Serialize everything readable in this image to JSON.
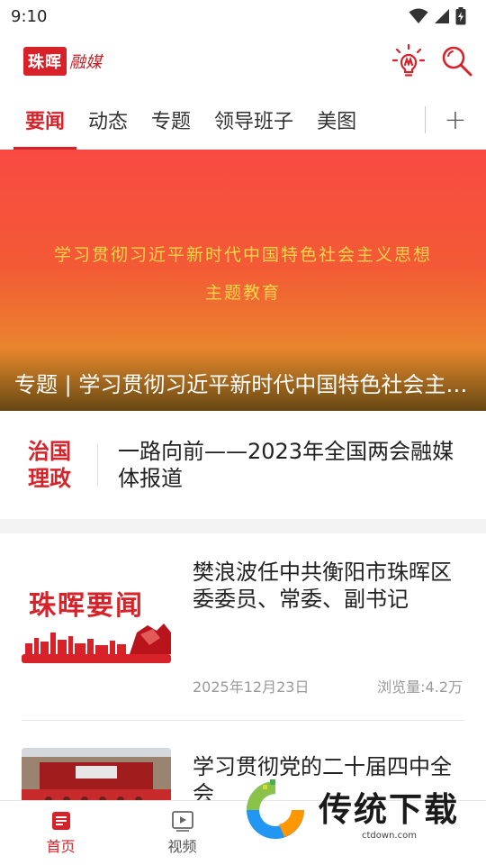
{
  "status_bar": {
    "time": "9:10"
  },
  "header": {
    "logo_badge": "珠晖",
    "logo_rest": "融媒",
    "icons": [
      "lightbulb-icon",
      "search-icon"
    ]
  },
  "tabs": [
    {
      "label": "要闻",
      "active": true
    },
    {
      "label": "动态",
      "active": false
    },
    {
      "label": "专题",
      "active": false
    },
    {
      "label": "领导班子",
      "active": false
    },
    {
      "label": "美图",
      "active": false
    }
  ],
  "tab_add_label": "+",
  "banner": {
    "slogan_line1": "学习贯彻习近平新时代中国特色社会主义思想",
    "slogan_line2": "主题教育",
    "caption": "专题 | 学习贯彻习近平新时代中国特色社会主义思想主题教育"
  },
  "feature": {
    "badge_line1": "治国",
    "badge_line2": "理政",
    "title": "一路向前——2023年全国两会融媒体报道"
  },
  "news": [
    {
      "thumb_text": "珠晖要闻",
      "title": "樊浪波任中共衡阳市珠晖区委委员、常委、副书记",
      "date": "2025年12月23日",
      "views": "浏览量:4.2万"
    },
    {
      "title": "学习贯彻党的二十届四中全会"
    }
  ],
  "bottom_nav": [
    {
      "label": "首页",
      "icon": "home-icon",
      "active": true
    },
    {
      "label": "视频",
      "icon": "video-icon",
      "active": false
    }
  ],
  "watermark": {
    "text": "传统下载",
    "sub": "ctdown.com"
  },
  "colors": {
    "brand_red": "#d8222a",
    "banner_top": "#f84a43",
    "banner_bottom": "#e39c2a",
    "slogan": "#fbd54a"
  }
}
